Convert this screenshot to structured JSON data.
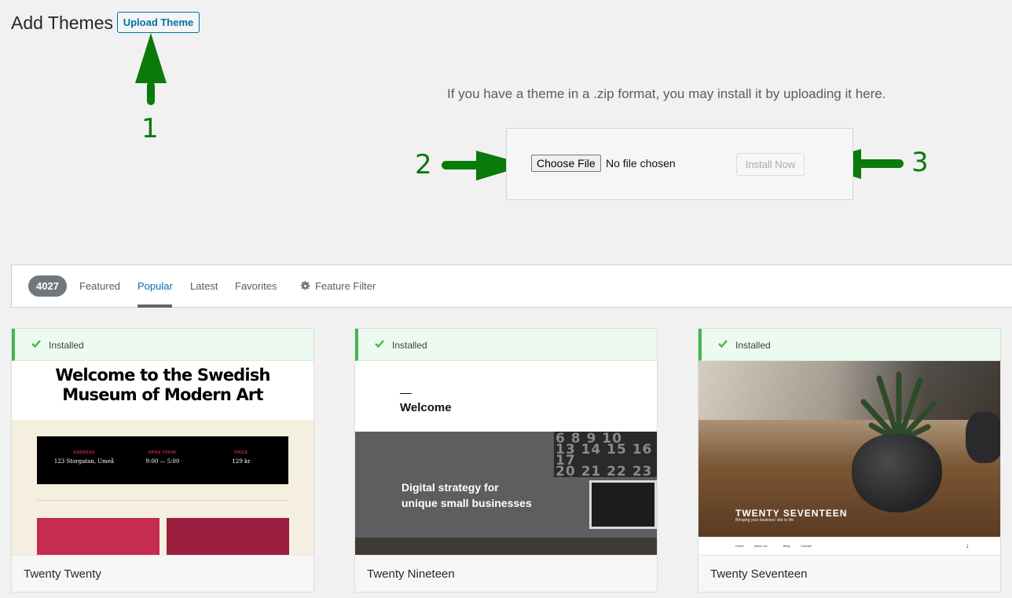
{
  "header": {
    "title": "Add Themes",
    "upload_button": "Upload Theme"
  },
  "annotations": [
    "1",
    "2",
    "3"
  ],
  "upload": {
    "help_text": "If you have a theme in a .zip format, you may install it by uploading it here.",
    "choose_file": "Choose File",
    "no_file": "No file chosen",
    "install_now": "Install Now"
  },
  "filter_bar": {
    "count": "4027",
    "tabs": [
      "Featured",
      "Popular",
      "Latest",
      "Favorites"
    ],
    "active_tab": "Popular",
    "feature_filter": "Feature Filter"
  },
  "themes": [
    {
      "name": "Twenty Twenty",
      "status": "Installed",
      "preview": {
        "heading_line1": "Welcome to the Swedish",
        "heading_line2": "Museum of Modern Art",
        "info": [
          {
            "label": "ADDRESS",
            "value": "123 Storgatan, Umeå"
          },
          {
            "label": "OPEN TODAY",
            "value": "9:00 — 5:00"
          },
          {
            "label": "PRICE",
            "value": "129 kr"
          }
        ]
      }
    },
    {
      "name": "Twenty Nineteen",
      "status": "Installed",
      "preview": {
        "welcome": "Welcome",
        "hero_line1": "Digital strategy for",
        "hero_line2": "unique small businesses"
      }
    },
    {
      "name": "Twenty Seventeen",
      "status": "Installed",
      "preview": {
        "site_title": "TWENTY SEVENTEEN",
        "tagline": "Bringing your business' site to life",
        "nav": [
          "Home",
          "About Us",
          "Blog",
          "Contact"
        ]
      }
    }
  ],
  "colors": {
    "accent": "#0073aa",
    "annotation": "#0a7a0a",
    "installed_green": "#46b450"
  }
}
